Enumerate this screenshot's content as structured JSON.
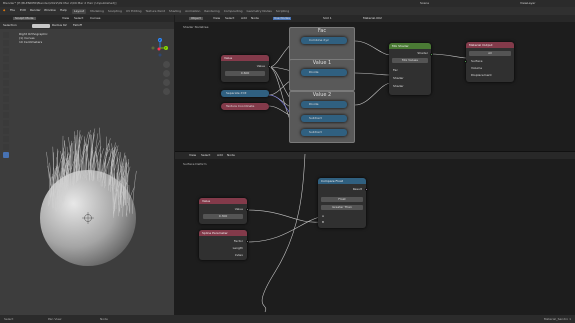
{
  "app": {
    "title": "Blender* [E:\\BLENDER\\Blender\\2022\\09 Mar 2\\09 Mar 2 Hair (Unpublished)]"
  },
  "topbar": {
    "menus": [
      "File",
      "Edit",
      "Render",
      "Window",
      "Help"
    ],
    "workspaces": [
      "Layout",
      "Modeling",
      "Sculpting",
      "UV Editing",
      "Texture Paint",
      "Shading",
      "Animation",
      "Rendering",
      "Compositing",
      "Geometry Nodes",
      "Scripting"
    ],
    "active_workspace": "Layout",
    "scene": "Scene",
    "view_layer": "ViewLayer"
  },
  "viewport": {
    "mode": "Sculpt Mode",
    "header_menus": [
      "View",
      "Select",
      "Curves"
    ],
    "toolbar_left": [
      "Selection",
      "Radius 62",
      "Falloff"
    ],
    "overlay_lines": [
      "Right Orthographic",
      "(1) Curves",
      "10 Centimeters"
    ],
    "axis_labels": {
      "y": "Y",
      "z": "Z"
    }
  },
  "shader_editor": {
    "header": {
      "object_btn": "Object",
      "menus": [
        "View",
        "Select",
        "Add",
        "Node"
      ],
      "slot": "Slot 1",
      "material": "Material.002",
      "use_nodes": "Use Nodes"
    },
    "breadcrumb": "Shader Nodetree",
    "nodes": {
      "value": {
        "title": "Value",
        "output": "Value",
        "field": "0.600"
      },
      "separate_xyz": {
        "title": "Separate XYZ"
      },
      "texture_coordinate": {
        "title": "Texture Coordinate"
      },
      "frame_fac": {
        "title": "Fac"
      },
      "frame_value1": {
        "title": "Value 1"
      },
      "frame_value2": {
        "title": "Value 2"
      },
      "combine_xyz": {
        "title": "Combine Xyz"
      },
      "divide": {
        "title": "Divide"
      },
      "divide2": {
        "title": "Divide"
      },
      "subtract": {
        "title": "Subtract"
      },
      "subtract2": {
        "title": "Subtract"
      },
      "mix_shader": {
        "title": "Mix Shader",
        "output": "Shader",
        "mode": "Mix Values",
        "inputs": [
          "Fac",
          "Shader",
          "Shader"
        ]
      },
      "material_output": {
        "title": "Material Output",
        "target": "All",
        "inputs": [
          "Surface",
          "Volume",
          "Displacement"
        ]
      }
    }
  },
  "geometry_editor": {
    "header": {
      "menus": [
        "View",
        "Select",
        "Add",
        "Node"
      ]
    },
    "breadcrumb": "Surface Deform",
    "nodes": {
      "value": {
        "title": "Value",
        "output": "Value",
        "field": "0.300"
      },
      "curve_info": {
        "title": "Spline Parameter",
        "outputs": [
          "Factor",
          "Length",
          "Index"
        ]
      },
      "compare": {
        "title": "Compare Float",
        "output": "Result",
        "fields": [
          "Float",
          "Greater Than"
        ],
        "inputs": [
          "A",
          "B"
        ]
      }
    }
  },
  "statusbar": {
    "left": [
      "Select",
      "Pan View",
      "Node"
    ],
    "right": "Material_Sandro 1"
  }
}
